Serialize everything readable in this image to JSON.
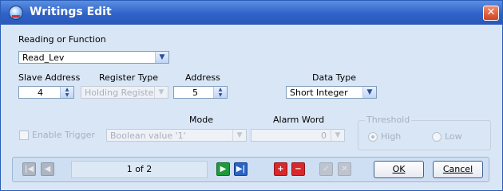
{
  "window": {
    "title": "Writings Edit"
  },
  "reading": {
    "label": "Reading or Function",
    "value": "Read_Lev"
  },
  "slave_address": {
    "label": "Slave Address",
    "value": "4"
  },
  "register_type": {
    "label": "Register Type",
    "value": "Holding Register"
  },
  "address": {
    "label": "Address",
    "value": "5"
  },
  "data_type": {
    "label": "Data Type",
    "value": "Short Integer"
  },
  "trigger": {
    "label": "Enable Trigger",
    "checked": false
  },
  "mode": {
    "label": "Mode",
    "value": "Boolean value '1'"
  },
  "alarm_word": {
    "label": "Alarm Word",
    "value": "0"
  },
  "threshold": {
    "label": "Threshold",
    "options": [
      "High",
      "Low"
    ],
    "selected": "High"
  },
  "navigation": {
    "page_text": "1 of 2"
  },
  "buttons": {
    "ok": "OK",
    "cancel": "Cancel"
  },
  "icons": {
    "close": "close-icon",
    "first": "first-record-icon",
    "previous": "previous-record-icon",
    "next": "next-record-icon",
    "last": "last-record-icon",
    "add": "add-icon",
    "remove": "remove-icon",
    "confirm": "confirm-icon",
    "discard": "discard-icon"
  },
  "colors": {
    "titlebar": "#2f62c8",
    "background": "#d9e6f6",
    "add_remove": "#d9282c",
    "next_green": "#1f9a3a",
    "last_blue": "#2a64c4"
  }
}
